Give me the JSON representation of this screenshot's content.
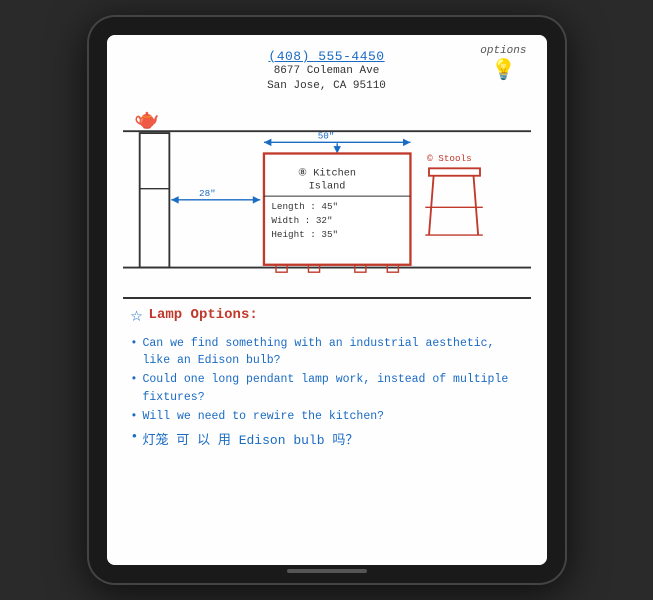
{
  "header": {
    "phone": "(408) 555-4450",
    "address_line1": "8677 Coleman Ave",
    "address_line2": "San Jose, CA 95110"
  },
  "options_label": "options",
  "diagram": {
    "measurement_28": "28\"",
    "measurement_50": "50\"",
    "island": {
      "circle_label": "⑧",
      "title": "Kitchen",
      "title2": "Island",
      "length": "Length : 45\"",
      "width": "Width : 32\"",
      "height": "Height : 35\""
    },
    "stool_label": "© Stools"
  },
  "notes": {
    "section_title": "Lamp Options:",
    "bullets": [
      "Can we find something with an industrial aesthetic, like an Edison bulb?",
      "Could one long pendant lamp work, instead of multiple fixtures?",
      "Will we need to rewire the kitchen?"
    ],
    "chinese_bullet": "灯笼 可 以 用  Edison  bulb  吗？"
  }
}
